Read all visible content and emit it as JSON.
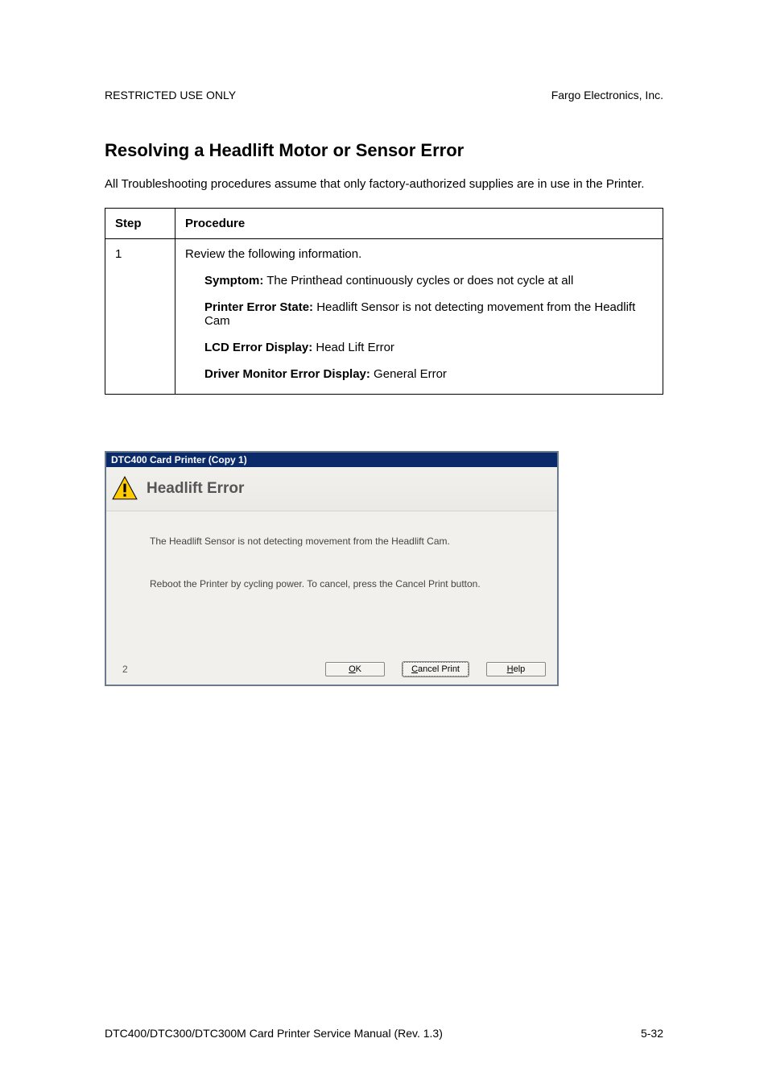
{
  "header": {
    "left": "RESTRICTED USE ONLY",
    "right": "Fargo Electronics, Inc."
  },
  "title": "Resolving a Headlift Motor or Sensor Error",
  "intro": "All Troubleshooting procedures assume that only factory-authorized supplies are in use in the Printer.",
  "table": {
    "headers": {
      "step": "Step",
      "procedure": "Procedure"
    },
    "rows": [
      {
        "step": "1",
        "lines": {
          "review": "Review the following information.",
          "symptom_label": "Symptom:",
          "symptom_text": " The Printhead continuously cycles or does not cycle at all",
          "state_label": "Printer Error State:",
          "state_text": " Headlift Sensor is not detecting movement from the Headlift Cam",
          "lcd_label": "LCD Error Display:",
          "lcd_text": " Head Lift Error",
          "driver_label": "Driver Monitor Error Display:",
          "driver_text": " General Error"
        }
      }
    ]
  },
  "dialog": {
    "titlebar": "DTC400 Card Printer (Copy 1)",
    "heading": "Headlift Error",
    "body1": "The Headlift Sensor is not detecting movement from the Headlift Cam.",
    "body2": "Reboot the Printer by cycling power. To cancel, press the Cancel Print button.",
    "page_num": "2",
    "buttons": {
      "ok": "OK",
      "cancel": "Cancel Print",
      "help": "Help"
    }
  },
  "footer": {
    "left": "DTC400/DTC300/DTC300M Card Printer Service Manual (Rev. 1.3)",
    "right": "5-32"
  }
}
